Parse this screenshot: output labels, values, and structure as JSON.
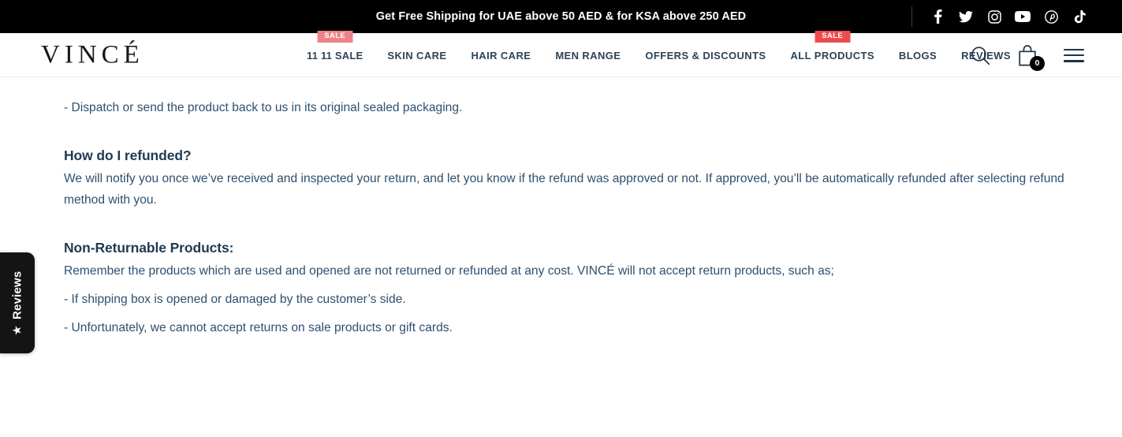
{
  "announcement": {
    "text": "Get Free Shipping for UAE above 50 AED & for KSA above 250 AED",
    "social": [
      {
        "name": "facebook-icon",
        "label": "Facebook"
      },
      {
        "name": "twitter-icon",
        "label": "Twitter"
      },
      {
        "name": "instagram-icon",
        "label": "Instagram"
      },
      {
        "name": "youtube-icon",
        "label": "YouTube"
      },
      {
        "name": "pinterest-icon",
        "label": "Pinterest"
      },
      {
        "name": "tiktok-icon",
        "label": "TikTok"
      }
    ]
  },
  "header": {
    "logo": "VINCÉ",
    "nav": [
      {
        "label": "11 11 SALE",
        "badge": "SALE",
        "badge_color": "#ef8289"
      },
      {
        "label": "SKIN CARE",
        "badge": "",
        "badge_color": ""
      },
      {
        "label": "HAIR CARE",
        "badge": "",
        "badge_color": ""
      },
      {
        "label": "MEN RANGE",
        "badge": "",
        "badge_color": ""
      },
      {
        "label": "OFFERS & DISCOUNTS",
        "badge": "",
        "badge_color": ""
      },
      {
        "label": "ALL PRODUCTS",
        "badge": "SALE",
        "badge_color": "#ee4b4f"
      },
      {
        "label": "BLOGS",
        "badge": "",
        "badge_color": ""
      },
      {
        "label": "REVIEWS",
        "badge": "",
        "badge_color": ""
      }
    ],
    "actions": {
      "search_label": "Search",
      "cart_label": "Cart",
      "cart_count": "0",
      "menu_label": "Menu"
    }
  },
  "content": {
    "bullet_dispatch": "- Dispatch or send the product back to us in its original sealed packaging.",
    "refund_heading": "How do I refunded?",
    "refund_paragraph": "We will notify you once we’ve received and inspected your return, and let you know if the refund was approved or not. If approved, you’ll be automatically refunded after selecting refund method with you.",
    "nonreturn_heading": "Non-Returnable Products:",
    "nonreturn_paragraph": "Remember the products which are used and opened are not returned or refunded at any cost. VINCÉ will not accept return products, such as;",
    "bullet_shipping_box": "- If shipping box is opened or damaged by the customer’s side.",
    "bullet_sale_products": "- Unfortunately, we cannot accept returns on sale products or gift cards."
  },
  "reviews_widget": {
    "label": "Reviews",
    "star": "★"
  }
}
